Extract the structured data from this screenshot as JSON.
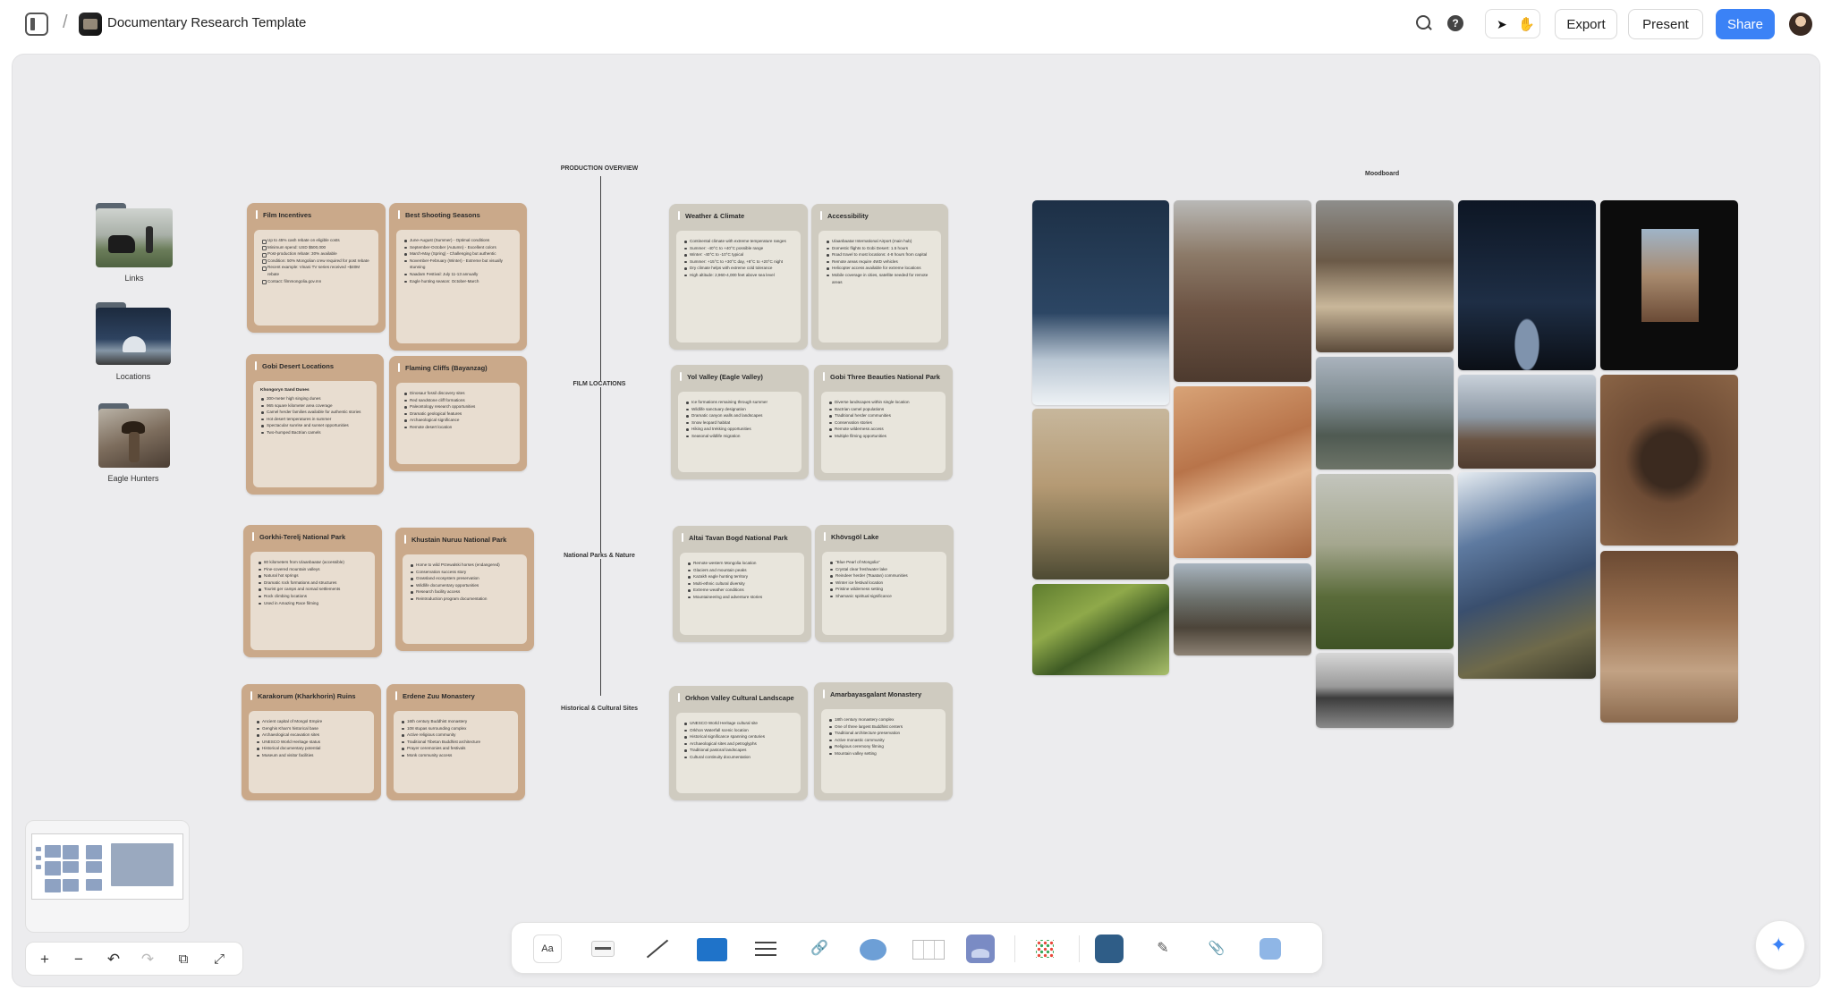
{
  "topbar": {
    "title": "Documentary Research Template",
    "export_label": "Export",
    "present_label": "Present",
    "share_label": "Share"
  },
  "folders": [
    {
      "label": "Links"
    },
    {
      "label": "Locations"
    },
    {
      "label": "Eagle Hunters"
    }
  ],
  "sections": {
    "production": "PRODUCTION OVERVIEW",
    "film_locations": "FILM LOCATIONS",
    "national_parks": "National Parks & Nature",
    "historical": "Historical & Cultural Sites"
  },
  "cards": {
    "film_incentives": {
      "title": "Film Incentives",
      "items": [
        "Up to 45% cash rebate on eligible costs",
        "Minimum spend: USD $500,000",
        "Post-production rebate: 30% available",
        "Condition: 50% Mongolian crew required for post rebate",
        "Recent example: Vinani TV series received ~$40M rebate",
        "Contact: filmmongolia.gov.mn"
      ]
    },
    "best_seasons": {
      "title": "Best Shooting Seasons",
      "items": [
        "June-August (Summer) - Optimal conditions",
        "September-October (Autumn) - Excellent colors",
        "March-May (Spring) - Challenging but authentic",
        "November-February (Winter) - Extreme but visually stunning",
        "Naadam Festival: July 11-13 annually",
        "Eagle hunting season: October-March"
      ]
    },
    "weather": {
      "title": "Weather & Climate",
      "items": [
        "Continental climate with extreme temperature ranges",
        "Summer: -40°C to +40°C possible range",
        "Winter: -40°C to -10°C typical",
        "Summer: +15°C to +30°C day, +8°C to +20°C night",
        "Dry climate helps with extreme cold tolerance",
        "High altitude: 2,960-4,000 feet above sea level"
      ]
    },
    "accessibility": {
      "title": "Accessibility",
      "items": [
        "Ulaanbaatar International Airport (main hub)",
        "Domestic flights to Gobi Desert: 1.5 hours",
        "Road travel to most locations: 4-8 hours from capital",
        "Remote areas require 4WD vehicles",
        "Helicopter access available for extreme locations",
        "Mobile coverage in cities, satellite needed for remote areas"
      ]
    },
    "gobi": {
      "title": "Gobi Desert Locations",
      "subtitle": "Khongoryn Sand Dunes",
      "items": [
        "300-meter high singing dunes",
        "965 square kilometer area coverage",
        "Camel herder families available for authentic stories",
        "Hot desert temperatures in summer",
        "Spectacular sunrise and sunset opportunities",
        "Two-humped Bactrian camels"
      ]
    },
    "flaming": {
      "title": "Flaming Cliffs (Bayanzag)",
      "items": [
        "Dinosaur fossil discovery sites",
        "Red sandstone cliff formations",
        "Paleontology research opportunities",
        "Dramatic geological features",
        "Archaeological significance",
        "Remote desert location"
      ]
    },
    "yol": {
      "title": "Yol Valley (Eagle Valley)",
      "items": [
        "Ice formations remaining through summer",
        "Wildlife sanctuary designation",
        "Dramatic canyon walls and landscapes",
        "Snow leopard habitat",
        "Hiking and trekking opportunities",
        "Seasonal wildlife migration"
      ]
    },
    "gobi3": {
      "title": "Gobi Three Beauties National Park",
      "items": [
        "Diverse landscapes within single location",
        "Bactrian camel populations",
        "Traditional herder communities",
        "Conservation stories",
        "Remote wilderness access",
        "Multiple filming opportunities"
      ]
    },
    "gorkhi": {
      "title": "Gorkhi-Terelj National Park",
      "items": [
        "80 kilometers from Ulaanbaatar (accessible)",
        "Pine-covered mountain valleys",
        "Natural hot springs",
        "Dramatic rock formations and structures",
        "Tourist ger camps and nomad settlements",
        "Rock climbing locations",
        "Used in Amazing Race filming"
      ]
    },
    "khustain": {
      "title": "Khustain Nuruu National Park",
      "items": [
        "Home to wild Przewalski horses (endangered)",
        "Conservation success story",
        "Grassland ecosystem preservation",
        "Wildlife documentary opportunities",
        "Research facility access",
        "Reintroduction program documentation"
      ]
    },
    "altai": {
      "title": "Altai Tavan Bogd National Park",
      "items": [
        "Remote western Mongolia location",
        "Glaciers and mountain peaks",
        "Kazakh eagle hunting territory",
        "Multi-ethnic cultural diversity",
        "Extreme weather conditions",
        "Mountaineering and adventure stories"
      ]
    },
    "khovsgol": {
      "title": "Khövsgöl Lake",
      "items": [
        "\"Blue Pearl of Mongolia\"",
        "Crystal clear freshwater lake",
        "Reindeer herder (Tsaatan) communities",
        "Winter ice festival location",
        "Pristine wilderness setting",
        "Shamanic spiritual significance"
      ]
    },
    "karakorum": {
      "title": "Karakorum (Kharkhorin) Ruins",
      "items": [
        "Ancient capital of Mongol Empire",
        "Genghis Khan's historical base",
        "Archaeological excavation sites",
        "UNESCO World Heritage status",
        "Historical documentary potential",
        "Museum and visitor facilities"
      ]
    },
    "erdene": {
      "title": "Erdene Zuu Monastery",
      "items": [
        "16th century Buddhist monastery",
        "108 stupas surrounding complex",
        "Active religious community",
        "Traditional Tibetan Buddhist architecture",
        "Prayer ceremonies and festivals",
        "Monk community access"
      ]
    },
    "orkhon": {
      "title": "Orkhon Valley Cultural Landscape",
      "items": [
        "UNESCO World Heritage cultural site",
        "Orkhon Waterfall scenic location",
        "Historical significance spanning centuries",
        "Archaeological sites and petroglyphs",
        "Traditional pastoral landscapes",
        "Cultural continuity documentation"
      ]
    },
    "amarbayasgalant": {
      "title": "Amarbayasgalant Monastery",
      "items": [
        "18th century monastery complex",
        "One of three largest Buddhist centers",
        "Traditional architecture preservation",
        "Active monastic community",
        "Religious ceremony filming",
        "Mountain valley setting"
      ]
    }
  },
  "moodboard": {
    "title": "Moodboard"
  },
  "colors": {
    "accent": "#3b82f6",
    "card_tan": "#caa98a",
    "card_gray": "#cfcbc0",
    "canvas": "#ececee"
  }
}
